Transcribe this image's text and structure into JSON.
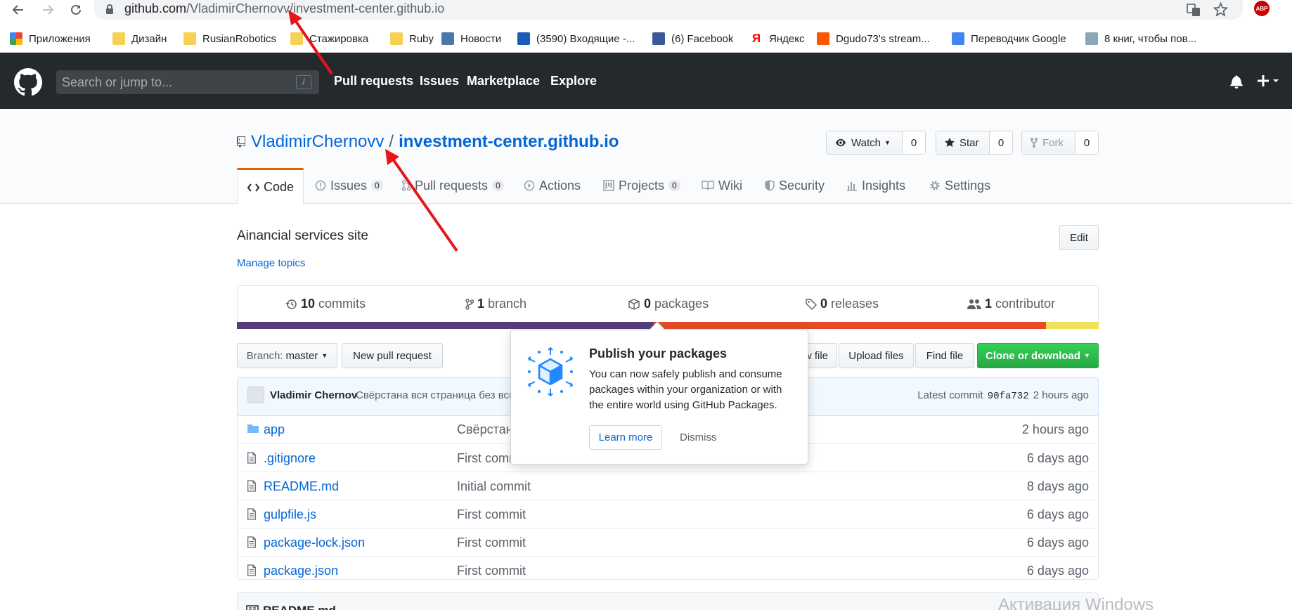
{
  "browser": {
    "url_host": "github.com",
    "url_path": "/VladimirChernovv/investment-center.github.io",
    "bookmarks": [
      {
        "label": "Приложения",
        "icon": "apps-grid-icon"
      },
      {
        "label": "Дизайн",
        "icon": "folder-icon"
      },
      {
        "label": "RusianRobotics",
        "icon": "folder-icon"
      },
      {
        "label": "Стажировка",
        "icon": "folder-icon"
      },
      {
        "label": "Ruby",
        "icon": "folder-icon"
      },
      {
        "label": "Новости",
        "icon": "vk-icon"
      },
      {
        "label": "(3590) Входящие -...",
        "icon": "mail-icon"
      },
      {
        "label": "(6) Facebook",
        "icon": "facebook-icon"
      },
      {
        "label": "Яндекс",
        "icon": "yandex-icon"
      },
      {
        "label": "Dgudo73's stream...",
        "icon": "soundcloud-icon"
      },
      {
        "label": "Переводчик Google",
        "icon": "google-translate-icon"
      },
      {
        "label": "8 книг, чтобы пов...",
        "icon": "bookmark-icon"
      }
    ],
    "abp_badge": "ABP"
  },
  "header": {
    "search_placeholder": "Search or jump to...",
    "slash_key": "/",
    "nav": [
      "Pull requests",
      "Issues",
      "Marketplace",
      "Explore"
    ]
  },
  "repo": {
    "owner": "VladimirChernovv",
    "separator": "/",
    "name": "investment-center.github.io",
    "watch_label": "Watch",
    "watch_count": "0",
    "star_label": "Star",
    "star_count": "0",
    "fork_label": "Fork",
    "fork_count": "0"
  },
  "tabs": [
    {
      "label": "Code"
    },
    {
      "label": "Issues",
      "count": "0"
    },
    {
      "label": "Pull requests",
      "count": "0"
    },
    {
      "label": "Actions"
    },
    {
      "label": "Projects",
      "count": "0"
    },
    {
      "label": "Wiki"
    },
    {
      "label": "Security"
    },
    {
      "label": "Insights"
    },
    {
      "label": "Settings"
    }
  ],
  "description": "Ainancial services site",
  "manage_topics": "Manage topics",
  "edit_label": "Edit",
  "summary": {
    "commits_num": "10",
    "commits_label": "commits",
    "branch_num": "1",
    "branch_label": "branch",
    "packages_num": "0",
    "packages_label": "packages",
    "releases_num": "0",
    "releases_label": "releases",
    "contributor_num": "1",
    "contributor_label": "contributor"
  },
  "language_colors": [
    "#563d7c",
    "#e34c26",
    "#f1e05a"
  ],
  "branch": {
    "prefix": "Branch:",
    "name": "master"
  },
  "new_pull_request": "New pull request",
  "create_file_fragment": "w file",
  "upload_files": "Upload files",
  "find_file": "Find file",
  "clone_download": "Clone or download",
  "commit": {
    "author": "Vladimir Chernov",
    "message": "Свёрстана вся страница без всп",
    "latest_label": "Latest commit",
    "sha": "90fa732",
    "age": "2 hours ago"
  },
  "files": [
    {
      "name": "app",
      "type": "dir",
      "message": "Свёрстана",
      "age": "2 hours ago"
    },
    {
      "name": ".gitignore",
      "type": "file",
      "message": "First comm",
      "age": "6 days ago"
    },
    {
      "name": "README.md",
      "type": "file",
      "message": "Initial commit",
      "age": "8 days ago"
    },
    {
      "name": "gulpfile.js",
      "type": "file",
      "message": "First commit",
      "age": "6 days ago"
    },
    {
      "name": "package-lock.json",
      "type": "file",
      "message": "First commit",
      "age": "6 days ago"
    },
    {
      "name": "package.json",
      "type": "file",
      "message": "First commit",
      "age": "6 days ago"
    }
  ],
  "readme_label": "README.md",
  "popover": {
    "title": "Publish your packages",
    "text": "You can now safely publish and consume packages within your organization or with the entire world using GitHub Packages.",
    "learn_more": "Learn more",
    "dismiss": "Dismiss"
  },
  "watermark": "Активация Windows",
  "colors": {
    "header_bg": "#24292e",
    "link": "#0366d6",
    "clone_green": "#28a745",
    "annotation_arrow": "#e8141c"
  }
}
